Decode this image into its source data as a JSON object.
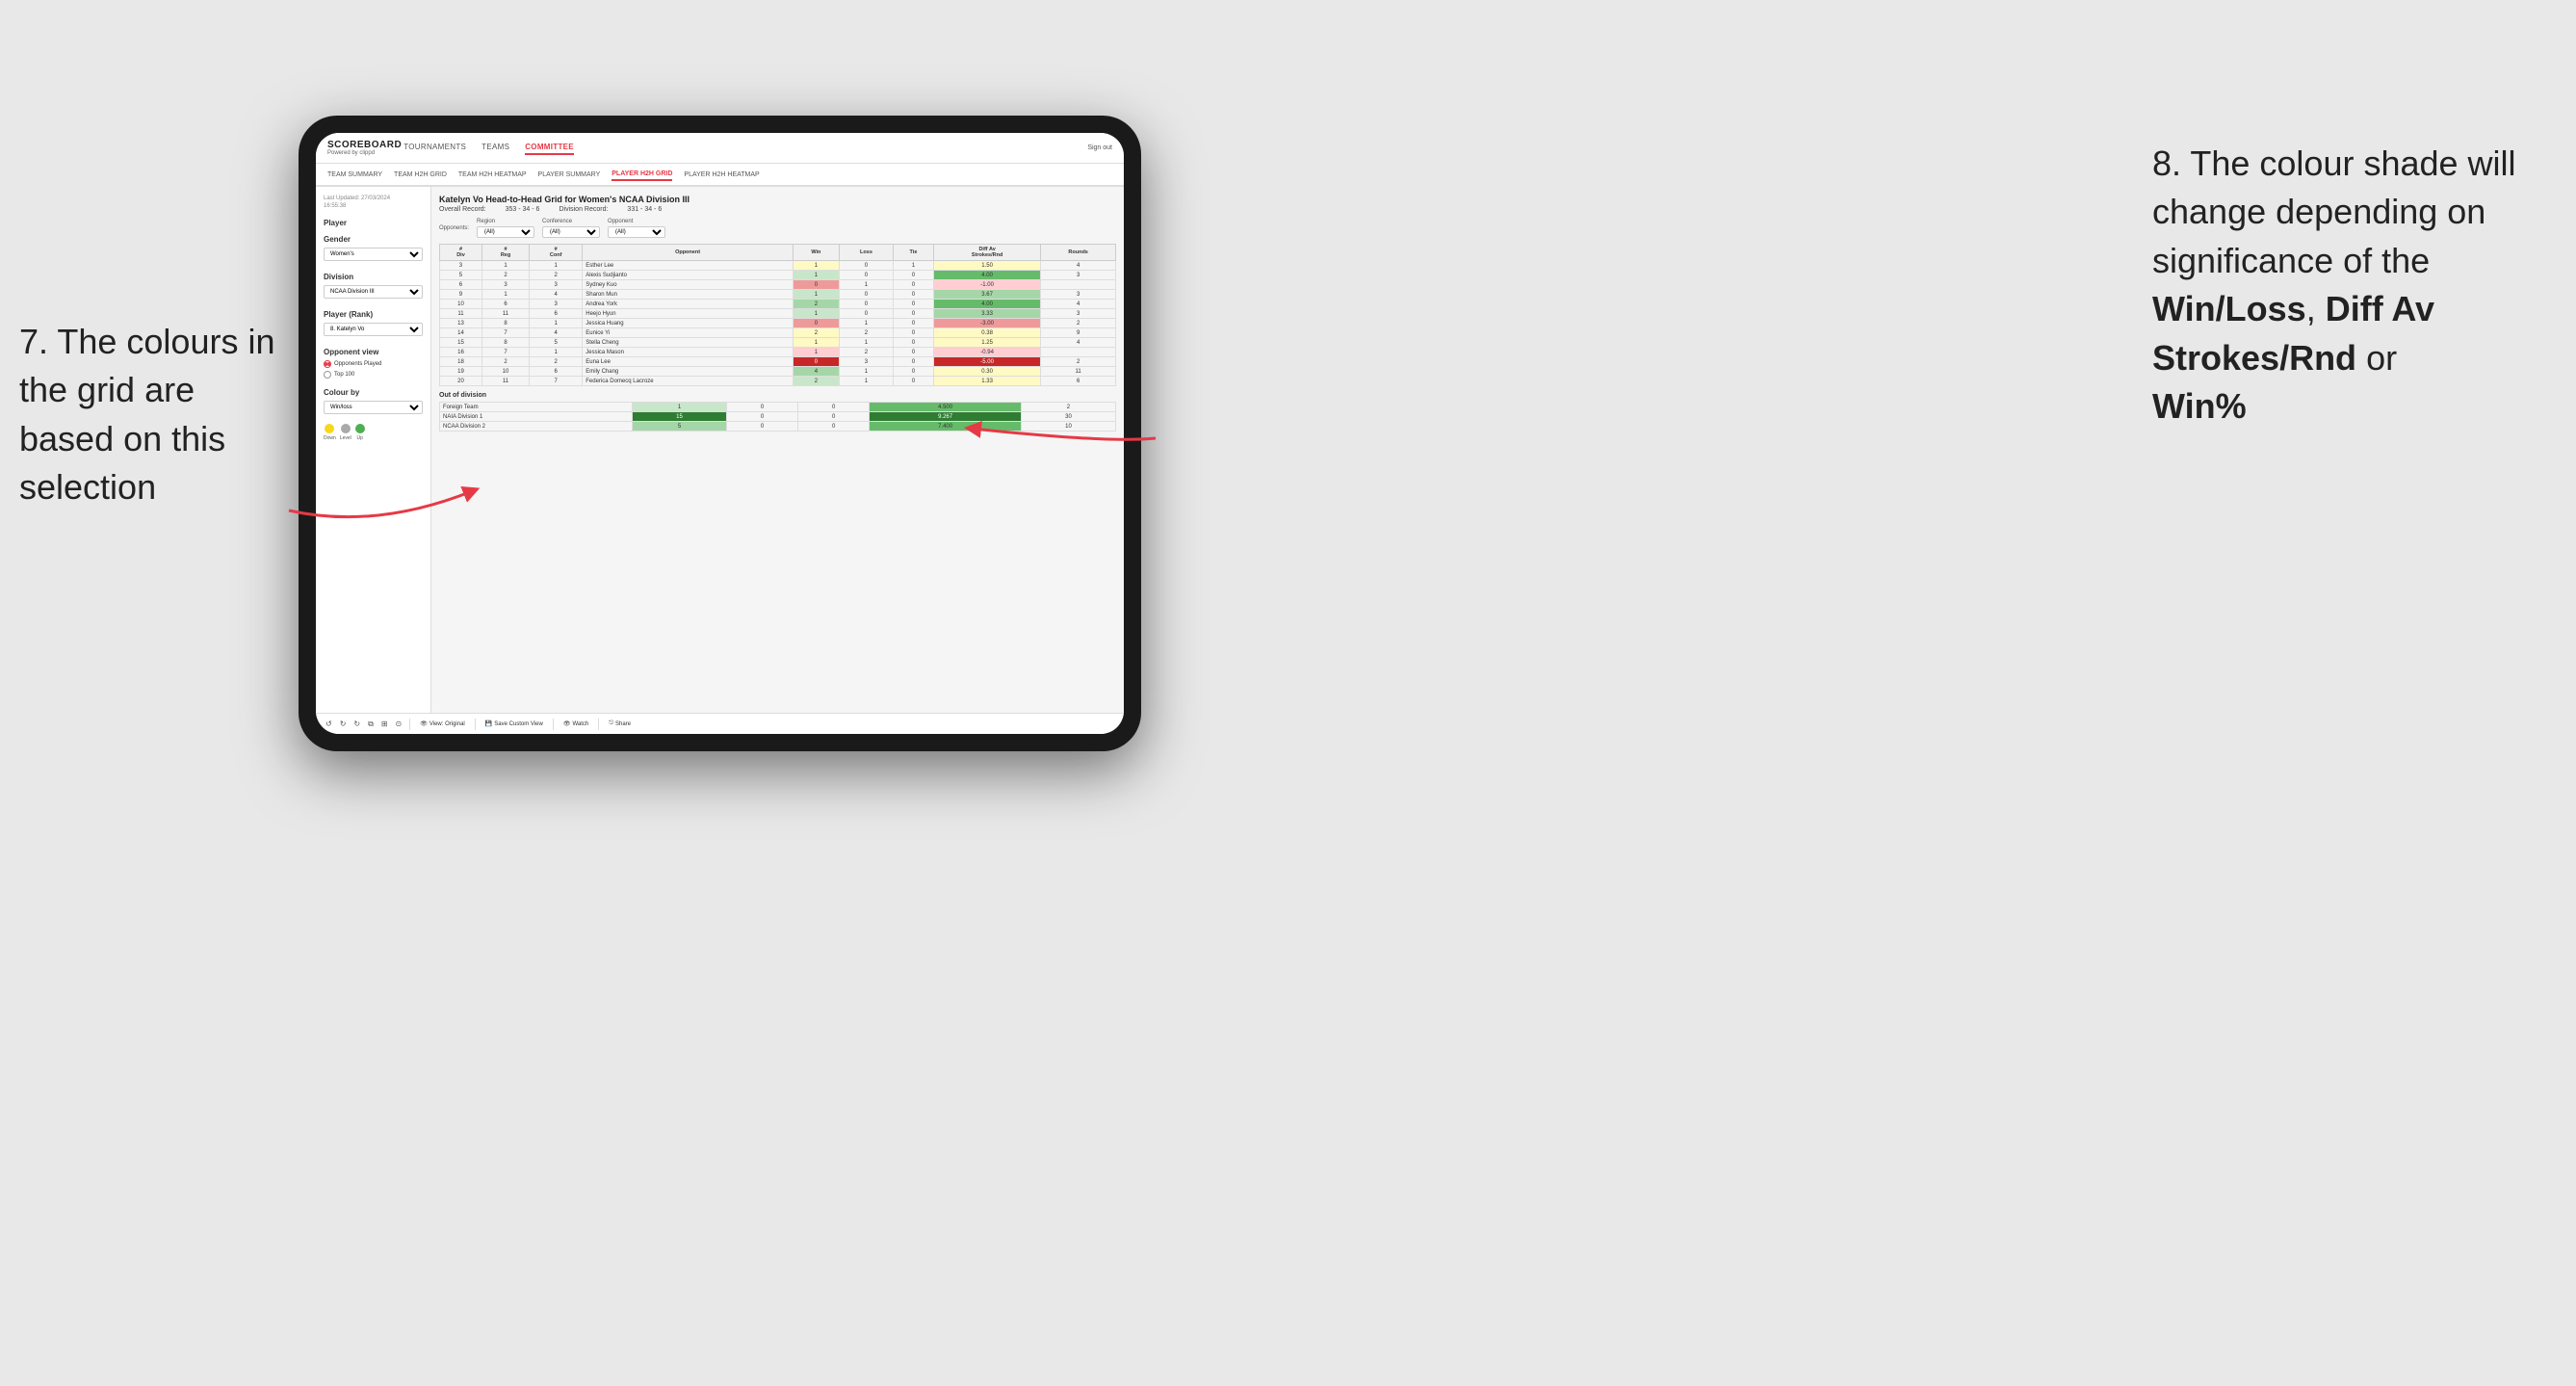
{
  "annotations": {
    "left_title": "7. The colours in the grid are based on this selection",
    "right_title": "8. The colour shade will change depending on significance of the",
    "right_bold1": "Win/Loss",
    "right_bold2": "Diff Av Strokes/Rnd",
    "right_bold3": "Win%"
  },
  "nav": {
    "logo": "SCOREBOARD",
    "logo_sub": "Powered by clippd",
    "items": [
      "TOURNAMENTS",
      "TEAMS",
      "COMMITTEE"
    ],
    "active": "COMMITTEE",
    "sign_out": "Sign out"
  },
  "sub_nav": {
    "items": [
      "TEAM SUMMARY",
      "TEAM H2H GRID",
      "TEAM H2H HEATMAP",
      "PLAYER SUMMARY",
      "PLAYER H2H GRID",
      "PLAYER H2H HEATMAP"
    ],
    "active": "PLAYER H2H GRID"
  },
  "left_panel": {
    "last_updated_label": "Last Updated: 27/03/2024",
    "last_updated_time": "16:55:38",
    "player_label": "Player",
    "gender_label": "Gender",
    "gender_value": "Women's",
    "division_label": "Division",
    "division_value": "NCAA Division III",
    "player_rank_label": "Player (Rank)",
    "player_rank_value": "8. Katelyn Vo",
    "opponent_view_label": "Opponent view",
    "opponent_played": "Opponents Played",
    "top_100": "Top 100",
    "colour_by_label": "Colour by",
    "colour_by_value": "Win/loss",
    "legend_down": "Down",
    "legend_level": "Level",
    "legend_up": "Up"
  },
  "grid": {
    "title": "Katelyn Vo Head-to-Head Grid for Women's NCAA Division III",
    "overall_record_label": "Overall Record:",
    "overall_record": "353 - 34 - 6",
    "division_record_label": "Division Record:",
    "division_record": "331 - 34 - 6",
    "filters": {
      "region_label": "Region",
      "region_value": "(All)",
      "conference_label": "Conference",
      "conference_value": "(All)",
      "opponent_label": "Opponent",
      "opponent_value": "(All)",
      "opponents_label": "Opponents:"
    },
    "columns": [
      "#\nDiv",
      "#\nReg",
      "#\nConf",
      "Opponent",
      "Win",
      "Loss",
      "Tie",
      "Diff Av\nStrokes/Rnd",
      "Rounds"
    ],
    "rows": [
      {
        "div": "3",
        "reg": "1",
        "conf": "1",
        "opponent": "Esther Lee",
        "win": 1,
        "loss": 0,
        "tie": 1,
        "diff": 1.5,
        "rounds": 4,
        "win_color": "yellow",
        "diff_color": "yellow"
      },
      {
        "div": "5",
        "reg": "2",
        "conf": "2",
        "opponent": "Alexis Sudjianto",
        "win": 1,
        "loss": 0,
        "tie": 0,
        "diff": 4.0,
        "rounds": 3,
        "win_color": "green-light",
        "diff_color": "green-dark"
      },
      {
        "div": "6",
        "reg": "3",
        "conf": "3",
        "opponent": "Sydney Kuo",
        "win": 0,
        "loss": 1,
        "tie": 0,
        "diff": -1.0,
        "rounds": "",
        "win_color": "red-mid",
        "diff_color": "red-light"
      },
      {
        "div": "9",
        "reg": "1",
        "conf": "4",
        "opponent": "Sharon Mun",
        "win": 1,
        "loss": 0,
        "tie": 0,
        "diff": 3.67,
        "rounds": 3,
        "win_color": "green-light",
        "diff_color": "green-mid"
      },
      {
        "div": "10",
        "reg": "6",
        "conf": "3",
        "opponent": "Andrea York",
        "win": 2,
        "loss": 0,
        "tie": 0,
        "diff": 4.0,
        "rounds": 4,
        "win_color": "green-mid",
        "diff_color": "green-dark"
      },
      {
        "div": "11",
        "reg": "11",
        "conf": "6",
        "opponent": "Heejo Hyun",
        "win": 1,
        "loss": 0,
        "tie": 0,
        "diff": 3.33,
        "rounds": 3,
        "win_color": "green-light",
        "diff_color": "green-mid"
      },
      {
        "div": "13",
        "reg": "8",
        "conf": "1",
        "opponent": "Jessica Huang",
        "win": 0,
        "loss": 1,
        "tie": 0,
        "diff": -3.0,
        "rounds": 2,
        "win_color": "red-mid",
        "diff_color": "red-mid"
      },
      {
        "div": "14",
        "reg": "7",
        "conf": "4",
        "opponent": "Eunice Yi",
        "win": 2,
        "loss": 2,
        "tie": 0,
        "diff": 0.38,
        "rounds": 9,
        "win_color": "yellow",
        "diff_color": "yellow"
      },
      {
        "div": "15",
        "reg": "8",
        "conf": "5",
        "opponent": "Stella Cheng",
        "win": 1,
        "loss": 1,
        "tie": 0,
        "diff": 1.25,
        "rounds": 4,
        "win_color": "yellow",
        "diff_color": "yellow"
      },
      {
        "div": "16",
        "reg": "7",
        "conf": "1",
        "opponent": "Jessica Mason",
        "win": 1,
        "loss": 2,
        "tie": 0,
        "diff": -0.94,
        "rounds": "",
        "win_color": "red-light",
        "diff_color": "red-light"
      },
      {
        "div": "18",
        "reg": "2",
        "conf": "2",
        "opponent": "Euna Lee",
        "win": 0,
        "loss": 3,
        "tie": 0,
        "diff": -5.0,
        "rounds": 2,
        "win_color": "red-dark",
        "diff_color": "red-dark"
      },
      {
        "div": "19",
        "reg": "10",
        "conf": "6",
        "opponent": "Emily Chang",
        "win": 4,
        "loss": 1,
        "tie": 0,
        "diff": 0.3,
        "rounds": 11,
        "win_color": "green-mid",
        "diff_color": "yellow"
      },
      {
        "div": "20",
        "reg": "11",
        "conf": "7",
        "opponent": "Federica Domecq Lacroze",
        "win": 2,
        "loss": 1,
        "tie": 0,
        "diff": 1.33,
        "rounds": 6,
        "win_color": "green-light",
        "diff_color": "yellow"
      }
    ],
    "out_of_division_label": "Out of division",
    "out_of_division_rows": [
      {
        "opponent": "Foreign Team",
        "win": 1,
        "loss": 0,
        "tie": 0,
        "diff": 4.5,
        "rounds": 2,
        "win_color": "green-light",
        "diff_color": "green-dark"
      },
      {
        "opponent": "NAIA Division 1",
        "win": 15,
        "loss": 0,
        "tie": 0,
        "diff": 9.267,
        "rounds": 30,
        "win_color": "green-dark",
        "diff_color": "green-dark"
      },
      {
        "opponent": "NCAA Division 2",
        "win": 5,
        "loss": 0,
        "tie": 0,
        "diff": 7.4,
        "rounds": 10,
        "win_color": "green-mid",
        "diff_color": "green-dark"
      }
    ]
  },
  "toolbar": {
    "view_original": "View: Original",
    "save_custom": "Save Custom View",
    "watch": "Watch",
    "share": "Share"
  },
  "colors": {
    "green_dark": "#2e7d32",
    "green_mid": "#81c784",
    "green_light": "#c8e6c9",
    "yellow": "#fff9c4",
    "red_light": "#ffcdd2",
    "red_mid": "#e57373",
    "red_dark": "#c62828",
    "accent": "#e63946"
  }
}
